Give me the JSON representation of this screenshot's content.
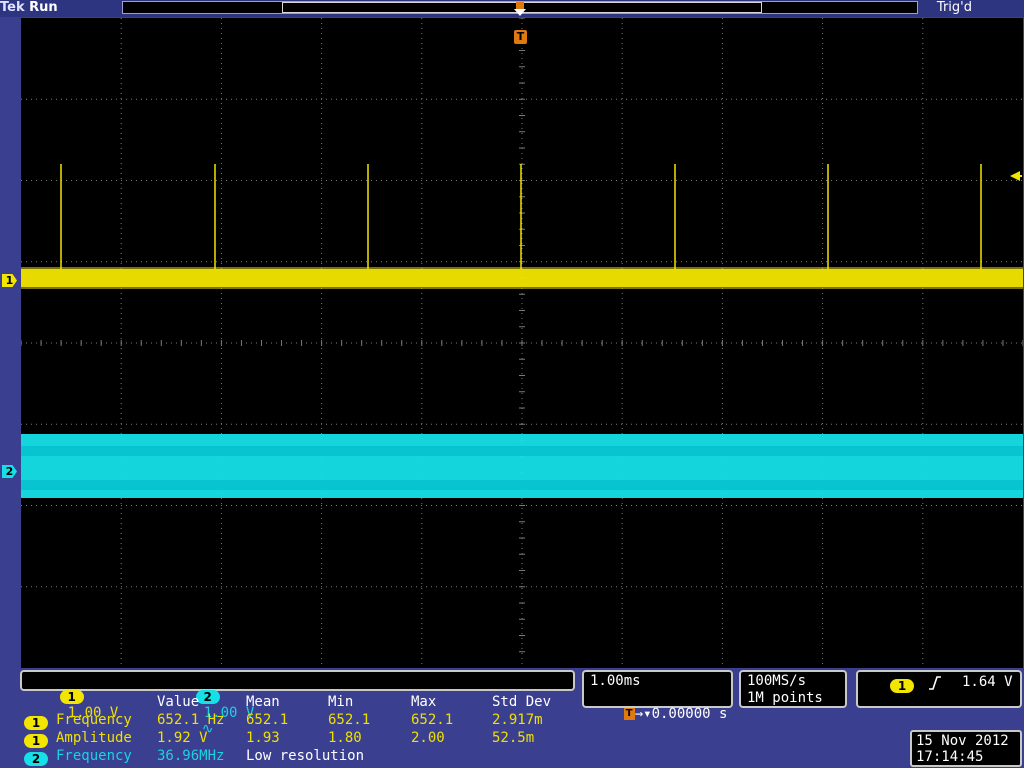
{
  "header": {
    "brand": "Tek",
    "state": "Run",
    "trigger_status": "Trig'd"
  },
  "markers": {
    "ch1": "1",
    "ch2": "2",
    "trigger_pos": "T",
    "ch1_color": "#f2e600",
    "ch2_color": "#15e0e8",
    "grid_color": "#7a7a7a"
  },
  "channel_settings": {
    "ch1_label": "1",
    "ch1_scale": "1.00 V",
    "ch2_label": "2",
    "ch2_scale": "1.00 V",
    "ch2_coupling_icon": "∿"
  },
  "timebase": {
    "scale": "1.00ms",
    "trigger_offset": "→▾0.00000 s",
    "sample_rate": "100MS/s",
    "record_length": "1M points"
  },
  "trigger": {
    "source": "1",
    "slope_icon": "rising-edge-icon",
    "level": "1.64 V"
  },
  "measurements": {
    "headers": [
      "Value",
      "Mean",
      "Min",
      "Max",
      "Std Dev"
    ],
    "rows": [
      {
        "ch": "1",
        "name": "Frequency",
        "value": "652.1 Hz",
        "mean": "652.1",
        "min": "652.1",
        "max": "652.1",
        "std": "2.917m"
      },
      {
        "ch": "1",
        "name": "Amplitude",
        "value": "1.92 V",
        "mean": "1.93",
        "min": "1.80",
        "max": "2.00",
        "std": "52.5m"
      },
      {
        "ch": "2",
        "name": "Frequency",
        "value": "36.96MHz",
        "mean": "Low resolution",
        "min": "",
        "max": "",
        "std": ""
      }
    ]
  },
  "datetime": {
    "date": "15 Nov 2012",
    "time": "17:14:45"
  }
}
